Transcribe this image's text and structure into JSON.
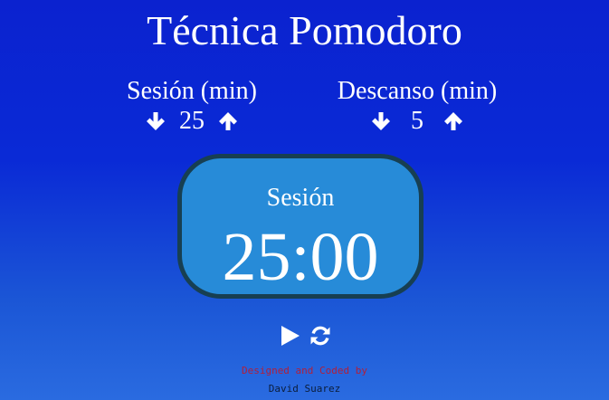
{
  "app": {
    "title": "Técnica Pomodoro"
  },
  "session": {
    "label": "Sesión (min)",
    "value": "25",
    "decrement_icon": "arrow-down-icon",
    "increment_icon": "arrow-up-icon"
  },
  "break": {
    "label": "Descanso (min)",
    "value": "5",
    "decrement_icon": "arrow-down-icon",
    "increment_icon": "arrow-up-icon"
  },
  "timer": {
    "label": "Sesión",
    "time": "25:00",
    "background": "#278bd8",
    "border": "#173f52"
  },
  "controls": {
    "play_icon": "play-icon",
    "reset_icon": "refresh-icon"
  },
  "footer": {
    "line1": "Designed and Coded by",
    "line2": "David Suarez",
    "line1_color": "#b21f3a",
    "line2_color": "#0b1d3a"
  }
}
